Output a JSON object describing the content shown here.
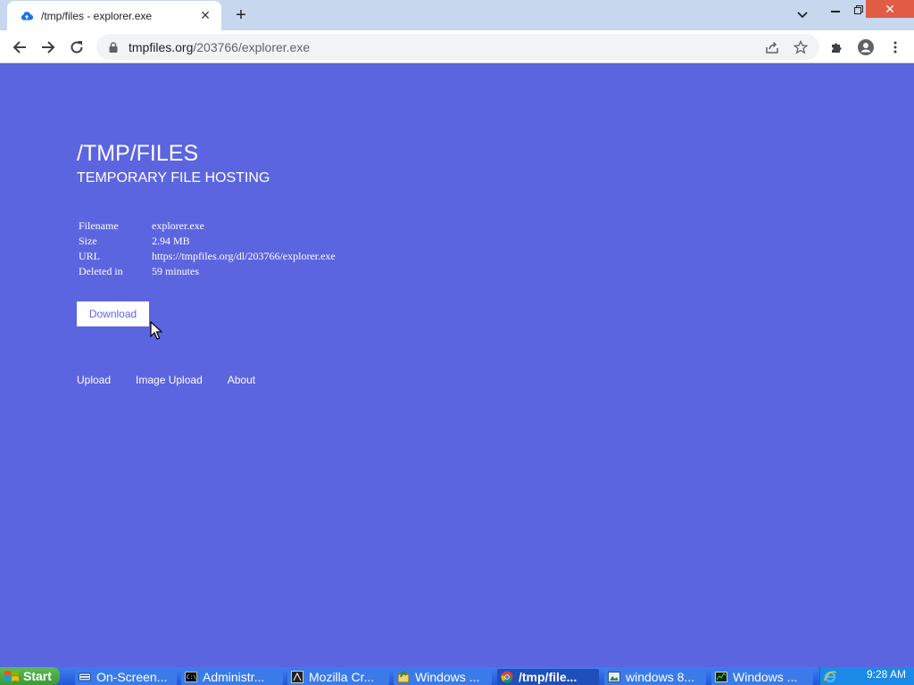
{
  "browser": {
    "tab_title": "/tmp/files - explorer.exe",
    "url_host": "tmpfiles.org",
    "url_path": "/203766/explorer.exe"
  },
  "page": {
    "title": "/TMP/FILES",
    "subtitle": "TEMPORARY FILE HOSTING",
    "info": [
      {
        "key": "Filename",
        "value": "explorer.exe"
      },
      {
        "key": "Size",
        "value": "2.94 MB"
      },
      {
        "key": "URL",
        "value": "https://tmpfiles.org/dl/203766/explorer.exe"
      },
      {
        "key": "Deleted in",
        "value": "59 minutes"
      }
    ],
    "download_label": "Download",
    "footer_links": [
      "Upload",
      "Image Upload",
      "About"
    ]
  },
  "taskbar": {
    "start_label": "Start",
    "tasks": [
      {
        "label": "On-Screen...",
        "active": false
      },
      {
        "label": "Administr...",
        "active": false
      },
      {
        "label": "Mozilla Cr...",
        "active": false
      },
      {
        "label": "Windows ...",
        "active": false
      },
      {
        "label": "/tmp/file...",
        "active": true
      },
      {
        "label": "windows 8...",
        "active": false
      },
      {
        "label": "Windows ...",
        "active": false
      }
    ],
    "clock": "9:28 AM"
  },
  "colors": {
    "page_background": "#5c65e0",
    "close_button": "#e25b45",
    "taskbar": "#2e6be0"
  }
}
